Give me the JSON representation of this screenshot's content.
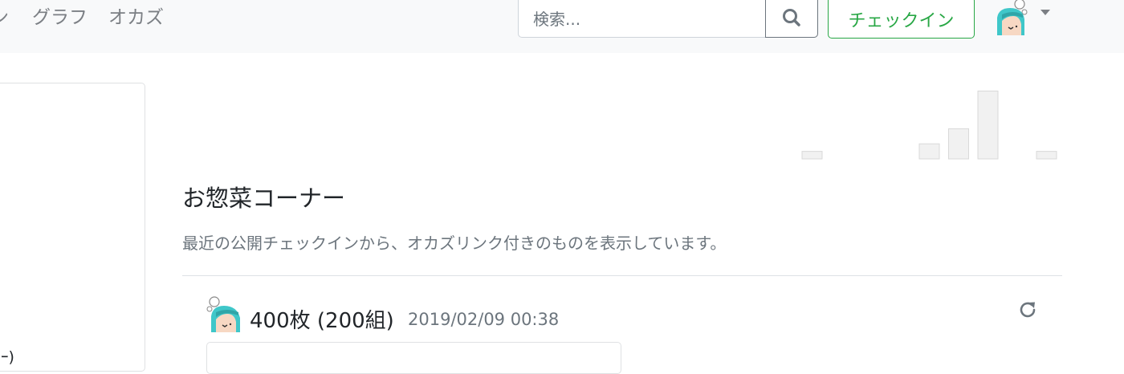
{
  "navbar": {
    "clipped_link": "ン",
    "graph_label": "グラフ",
    "okazu_label": "オカズ",
    "search": {
      "placeholder": "検索...",
      "value": ""
    },
    "search_button_icon": "search-icon",
    "checkin_label": "チェックイン",
    "user_menu": {
      "avatar": "user-avatar",
      "caret_icon": "caret-down-icon"
    }
  },
  "left_card": {
    "partial_text": "ｰ)"
  },
  "sparkline": {
    "values": [
      1,
      0,
      0,
      0,
      2,
      4,
      9,
      0,
      1
    ],
    "color": "#f1f1f1",
    "stroke": "#d9d9d9"
  },
  "main": {
    "title": "お惣菜コーナー",
    "description": "最近の公開チェックインから、オカズリンク付きのものを表示しています。",
    "item": {
      "title": "400枚 (200組)",
      "time": "2019/02/09 00:38",
      "reload_icon": "reload-icon"
    }
  },
  "colors": {
    "accent_green": "#28a745",
    "muted": "#6c757d",
    "navbar_bg": "#f8f9fa"
  }
}
